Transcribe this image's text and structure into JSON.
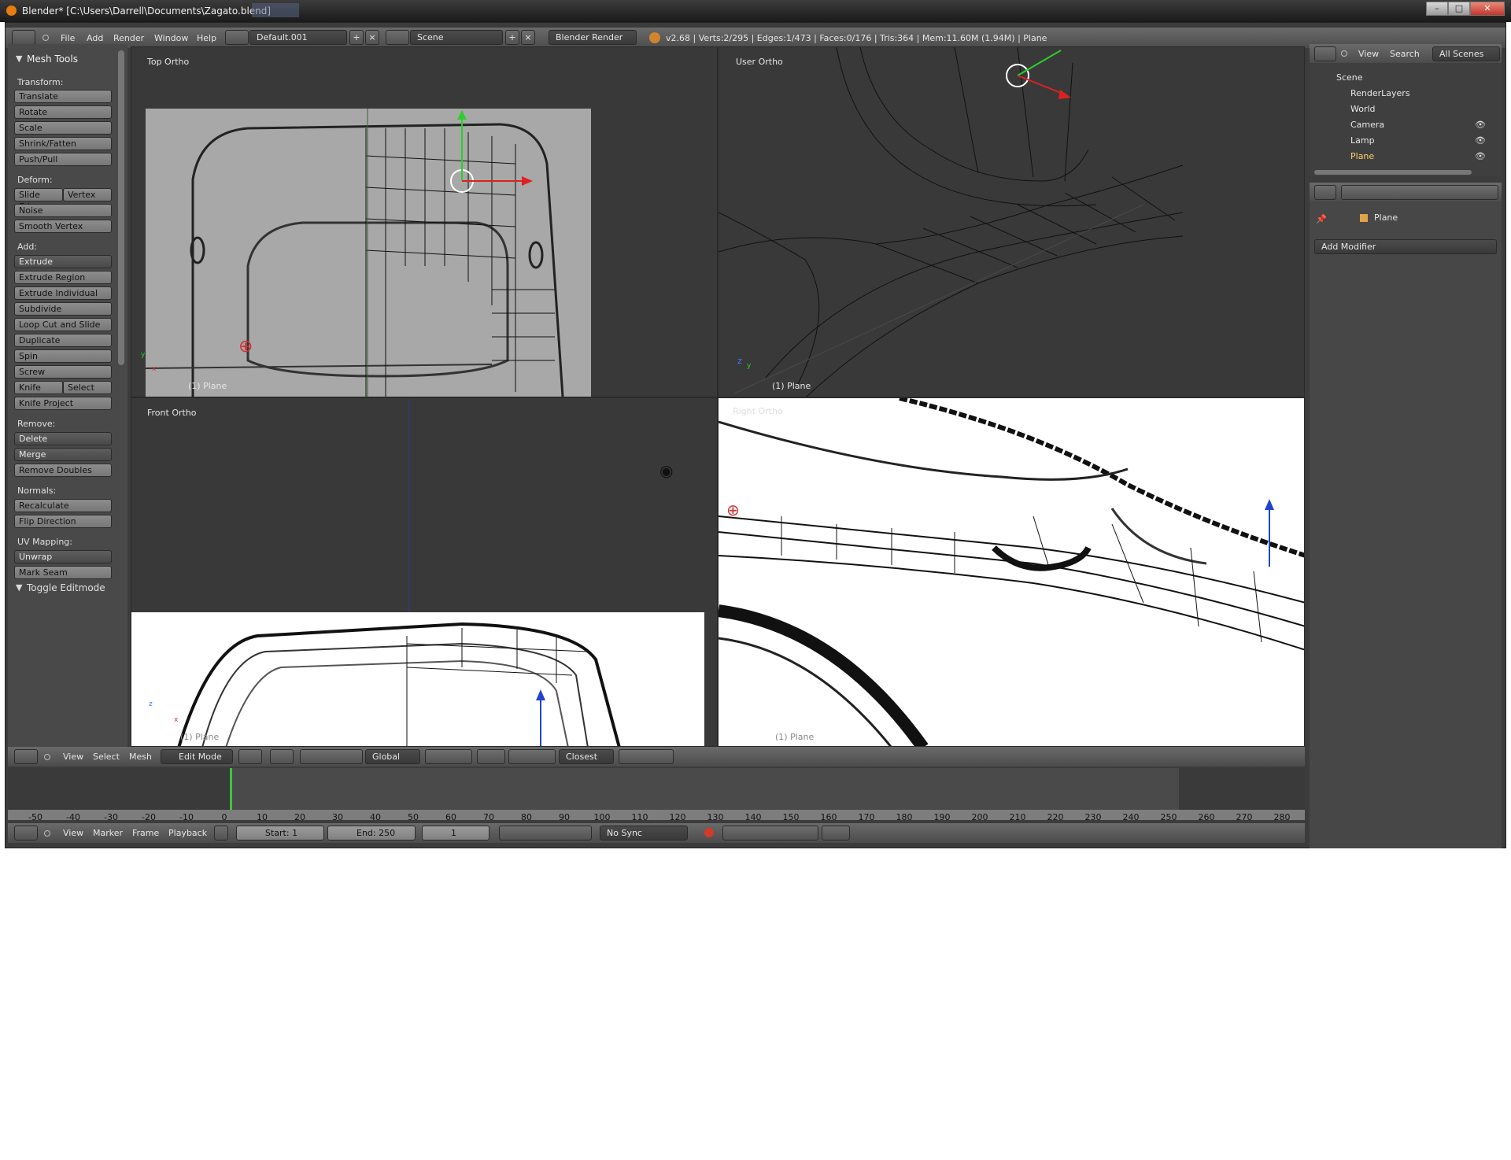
{
  "window": {
    "title": "Blender* [C:\\Users\\Darrell\\Documents\\Zagato.blend]",
    "minimize": "–",
    "maximize": "□",
    "close": "✕"
  },
  "info_header": {
    "menus": [
      "File",
      "Add",
      "Render",
      "Window",
      "Help"
    ],
    "screen_layout": "Default.001",
    "scene": "Scene",
    "render_engine": "Blender Render",
    "stats": "v2.68 | Verts:2/295 | Edges:1/473 | Faces:0/176 | Tris:364 | Mem:11.60M (1.94M) | Plane"
  },
  "tool_shelf": {
    "title": "Mesh Tools",
    "transform_label": "Transform:",
    "transform": [
      "Translate",
      "Rotate",
      "Scale",
      "Shrink/Fatten",
      "Push/Pull"
    ],
    "deform_label": "Deform:",
    "slide_edge": "Slide Edge",
    "vertex": "Vertex",
    "noise": "Noise",
    "smooth_vertex": "Smooth Vertex",
    "add_label": "Add:",
    "extrude": "Extrude",
    "add": [
      "Extrude Region",
      "Extrude Individual",
      "Subdivide",
      "Loop Cut and Slide",
      "Duplicate",
      "Spin",
      "Screw"
    ],
    "knife": "Knife",
    "select": "Select",
    "knife_project": "Knife Project",
    "remove_label": "Remove:",
    "delete": "Delete",
    "merge": "Merge",
    "remove_doubles": "Remove Doubles",
    "normals_label": "Normals:",
    "recalculate": "Recalculate",
    "flip_direction": "Flip Direction",
    "uv_label": "UV Mapping:",
    "unwrap": "Unwrap",
    "mark_seam": "Mark Seam",
    "toggle_editmode": "Toggle Editmode"
  },
  "viewports": {
    "top": {
      "label": "Top Ortho",
      "object": "(1) Plane"
    },
    "user": {
      "label": "User Ortho",
      "object": "(1) Plane"
    },
    "front": {
      "label": "Front Ortho",
      "object": "(1) Plane"
    },
    "right": {
      "label": "Right Ortho",
      "object": "(1) Plane"
    }
  },
  "view3d_header": {
    "menus": [
      "View",
      "Select",
      "Mesh"
    ],
    "mode": "Edit Mode",
    "orientation": "Global",
    "snap_target": "Closest"
  },
  "outliner": {
    "menus": [
      "View",
      "Search"
    ],
    "filter": "All Scenes",
    "tree": [
      "Scene",
      "RenderLayers",
      "World",
      "Camera",
      "Lamp",
      "Plane"
    ]
  },
  "properties": {
    "object_name": "Plane",
    "add_modifier": "Add Modifier"
  },
  "timeline": {
    "ticks": [
      "-50",
      "-40",
      "-30",
      "-20",
      "-10",
      "0",
      "10",
      "20",
      "30",
      "40",
      "50",
      "60",
      "70",
      "80",
      "90",
      "100",
      "110",
      "120",
      "130",
      "140",
      "150",
      "160",
      "170",
      "180",
      "190",
      "200",
      "210",
      "220",
      "230",
      "240",
      "250",
      "260",
      "270",
      "280"
    ],
    "menus": [
      "View",
      "Marker",
      "Frame",
      "Playback"
    ],
    "start": "Start: 1",
    "end": "End: 250",
    "current": "1",
    "sync": "No Sync"
  }
}
